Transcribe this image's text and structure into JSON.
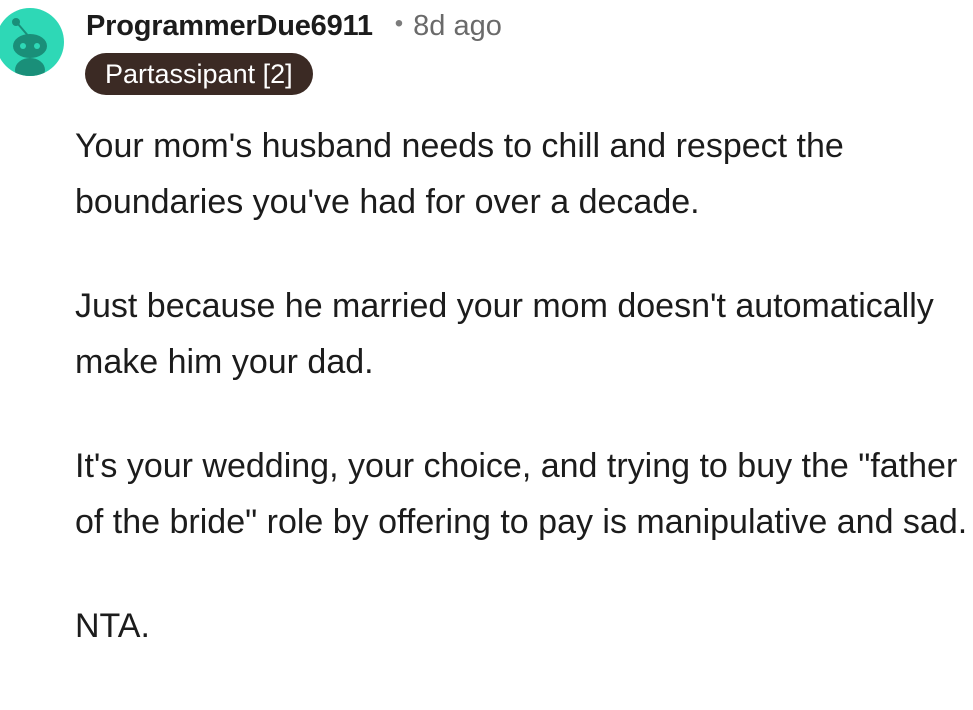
{
  "comment": {
    "author": "ProgrammerDue6911",
    "separator": "•",
    "time_ago": "8d ago",
    "flair": "Partassipant [2]",
    "avatar_icon": "snoo-avatar-icon",
    "avatar_color": "#2ed8b6",
    "flair_color": "#3b2a24",
    "paragraphs": [
      "Your mom's husband needs to chill and respect the boundaries you've had for over a decade.",
      "Just because he married your mom doesn't automatically make him your dad.",
      "It's your wedding, your choice, and trying to buy the \"father of the bride\" role by offering to pay is manipulative and sad.",
      "NTA."
    ]
  }
}
